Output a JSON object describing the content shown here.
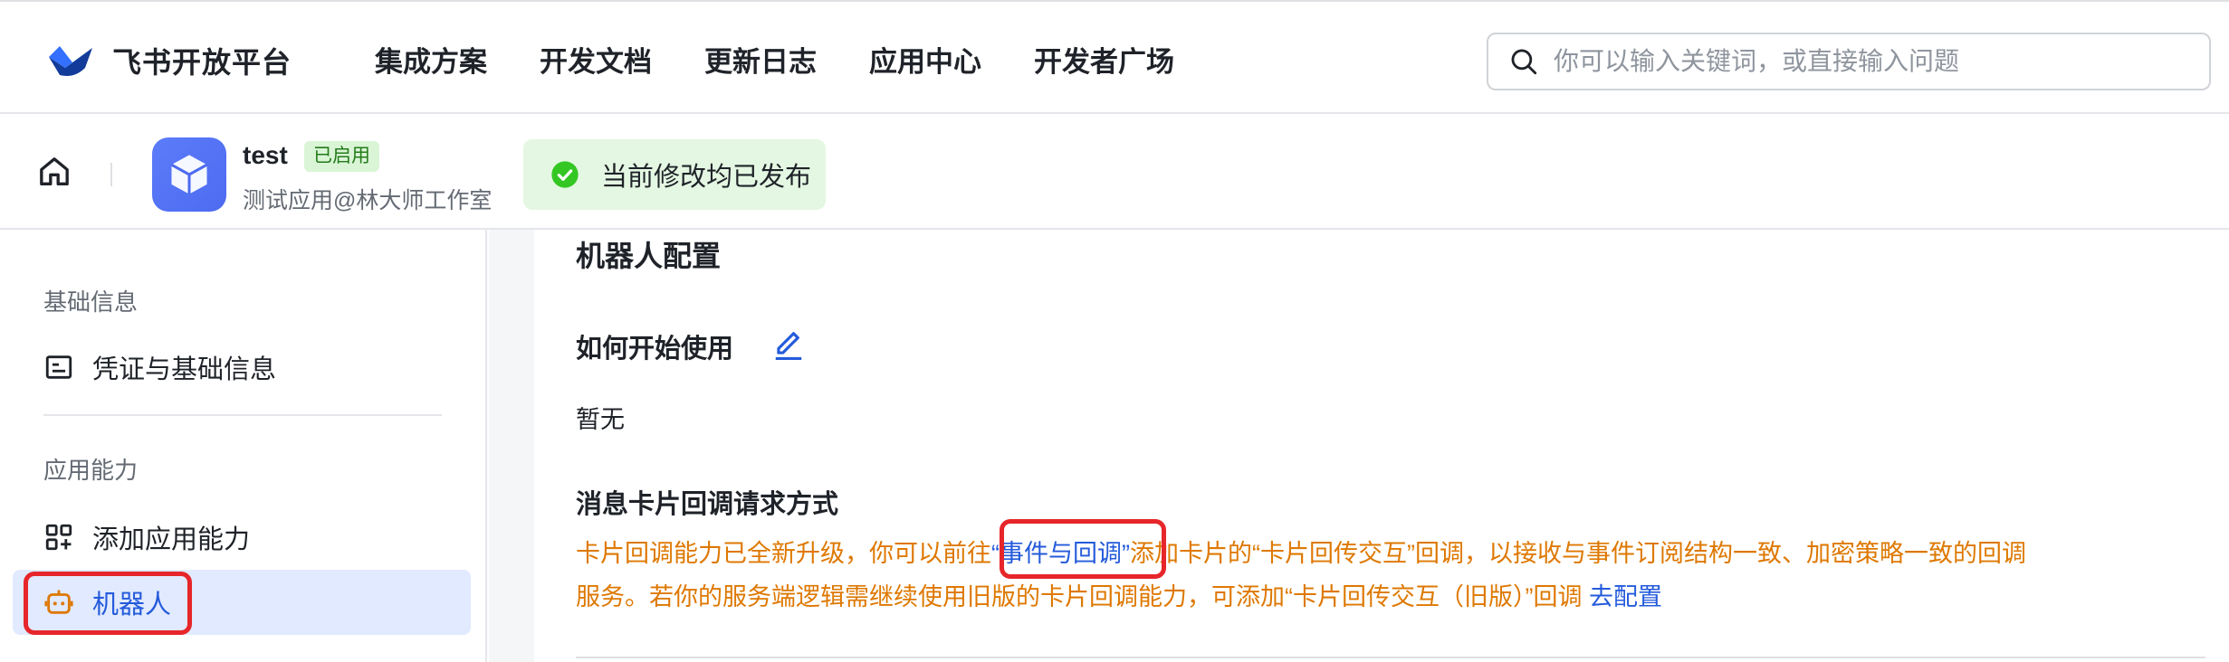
{
  "header": {
    "logo_text": "飞书开放平台",
    "nav": [
      "集成方案",
      "开发文档",
      "更新日志",
      "应用中心",
      "开发者广场"
    ],
    "search_placeholder": "你可以输入关键词，或直接输入问题"
  },
  "app": {
    "name": "test",
    "status_badge": "已启用",
    "subtitle": "测试应用@林大师工作室"
  },
  "toast": {
    "text": "当前修改均已发布"
  },
  "sidebar": {
    "group1": "基础信息",
    "item_credentials": "凭证与基础信息",
    "group2": "应用能力",
    "item_add_capability": "添加应用能力",
    "item_robot": "机器人"
  },
  "main": {
    "title": "机器人配置",
    "how_to_use": "如何开始使用",
    "how_to_use_value": "暂无",
    "callback_title": "消息卡片回调请求方式",
    "notice_part1": "卡片回调能力已全新升级，你可以前往",
    "notice_link": "“事件与回调”",
    "notice_part2": "添加卡片的“卡片回传交互”回调，以接收与事件订阅结构一致、加密策略一致的回调服务。若你的服务端逻辑需继续使用旧版的卡片回调能力，可添加“卡片回传交互（旧版）”回调 ",
    "notice_config_link": "去配置"
  },
  "colors": {
    "accent": "#245bdb",
    "warning_text": "#de7802",
    "highlight": "#e6262a",
    "active_bg": "#e1eaff"
  }
}
